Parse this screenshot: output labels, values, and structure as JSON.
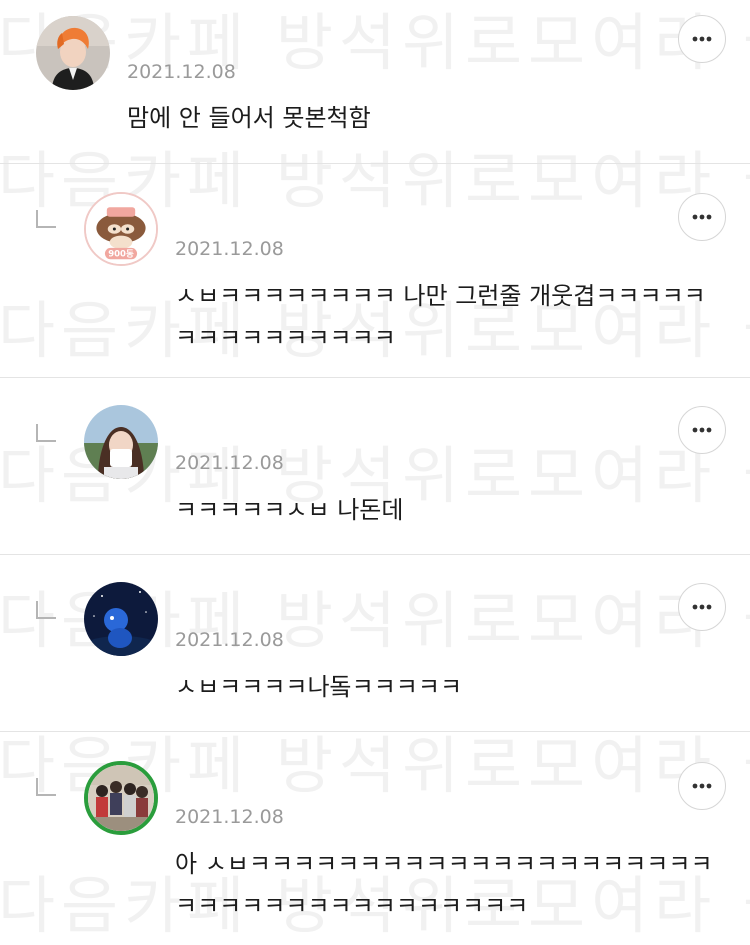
{
  "watermark": "다음카페 방석위로모여라 불펌금지",
  "comments": [
    {
      "date": "2021.12.08",
      "text": "맘에 안 들어서 못본척함",
      "is_reply": false
    },
    {
      "date": "2021.12.08",
      "text": "ㅅㅂㅋㅋㅋㅋㅋㅋㅋㅋ 나만 그런줄 개웃겹ㅋㅋㅋㅋㅋㅋㅋㅋㅋㅋㅋㅋㅋㅋㅋ",
      "is_reply": true,
      "avatar_badge": "900동"
    },
    {
      "date": "2021.12.08",
      "text": "ㅋㅋㅋㅋㅋㅅㅂ 나돈데",
      "is_reply": true
    },
    {
      "date": "2021.12.08",
      "text": "ㅅㅂㅋㅋㅋㅋ나돜ㅋㅋㅋㅋㅋ",
      "is_reply": true
    },
    {
      "date": "2021.12.08",
      "text": "아 ㅅㅂㅋㅋㅋㅋㅋㅋㅋㅋㅋㅋㅋㅋㅋㅋㅋㅋㅋㅋㅋㅋㅋㅋㅋㅋㅋㅋㅋㅋㅋㅋㅋㅋㅋㅋㅋㅋㅋ",
      "is_reply": true
    }
  ],
  "colors": {
    "date": "#9a9a9a",
    "divider": "#e4e4e4",
    "avatar_ring_5": "#2a9d3c"
  },
  "icons": {
    "more": "more-horizontal-icon",
    "reply": "reply-indent-icon"
  }
}
